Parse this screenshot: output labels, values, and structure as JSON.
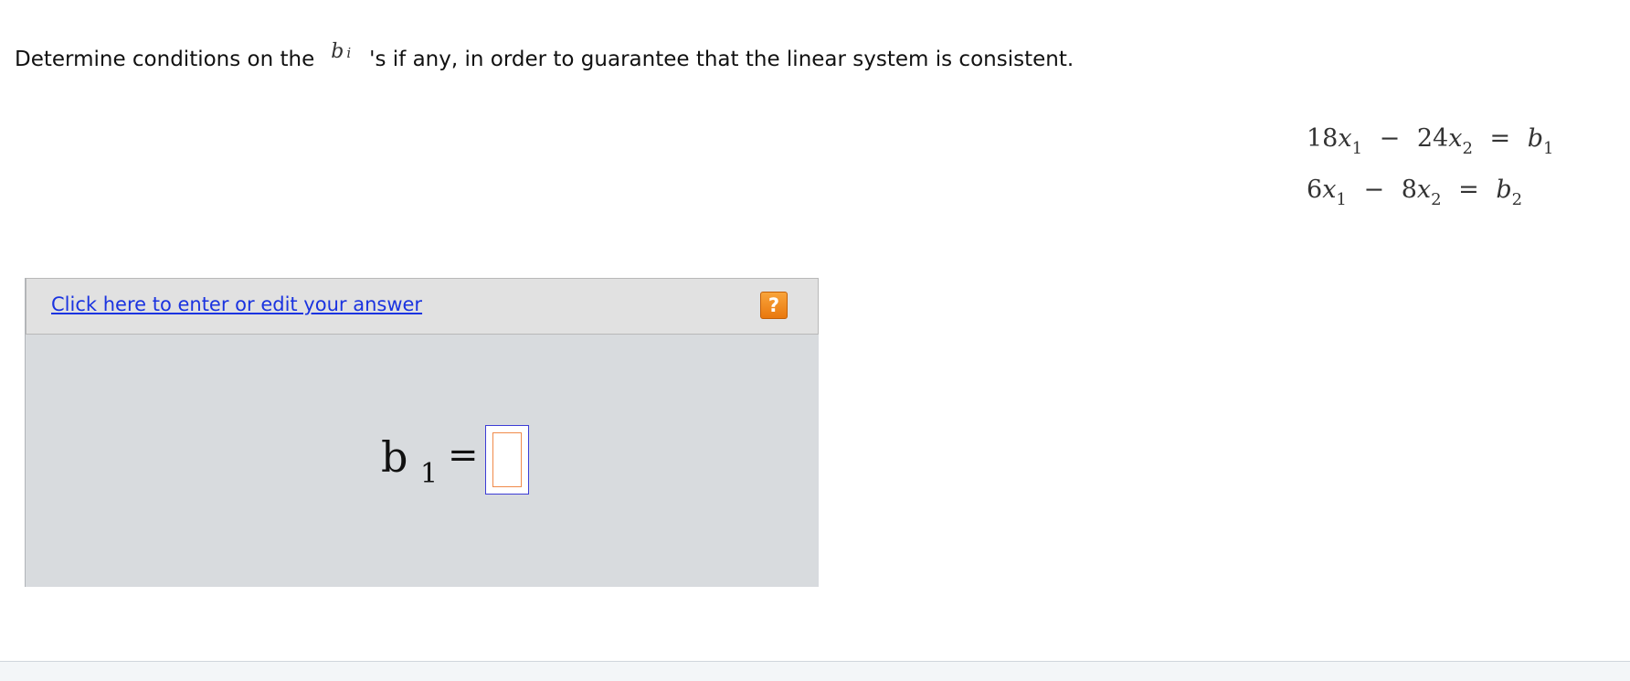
{
  "question": {
    "prefix": "Determine conditions on the",
    "variable": "b",
    "variable_sub": "i",
    "suffix": "'s if any, in order to guarantee that the linear system is consistent."
  },
  "equations": [
    {
      "a_coef": "18",
      "a_var": "x",
      "a_sub": "1",
      "op": "−",
      "b_coef": "24",
      "b_var": "x",
      "b_sub": "2",
      "eq": "=",
      "rhs_var": "b",
      "rhs_sub": "1"
    },
    {
      "a_coef": "6",
      "a_var": "x",
      "a_sub": "1",
      "op": "−",
      "b_coef": "8",
      "b_var": "x",
      "b_sub": "2",
      "eq": "=",
      "rhs_var": "b",
      "rhs_sub": "2"
    }
  ],
  "answer_panel": {
    "edit_link_label": "Click here to enter or edit your answer",
    "help_label": "?",
    "formula_var": "b",
    "formula_sub": "1",
    "formula_eq": "=",
    "answer_value": ""
  },
  "colors": {
    "link": "#1a33e0",
    "help_button": "#f28c1c",
    "panel_bg": "#d8dbde",
    "answer_box_border": "#3d3dd6",
    "answer_inner_border": "#f08a4a"
  },
  "icons": {
    "help": "question-mark-icon"
  }
}
